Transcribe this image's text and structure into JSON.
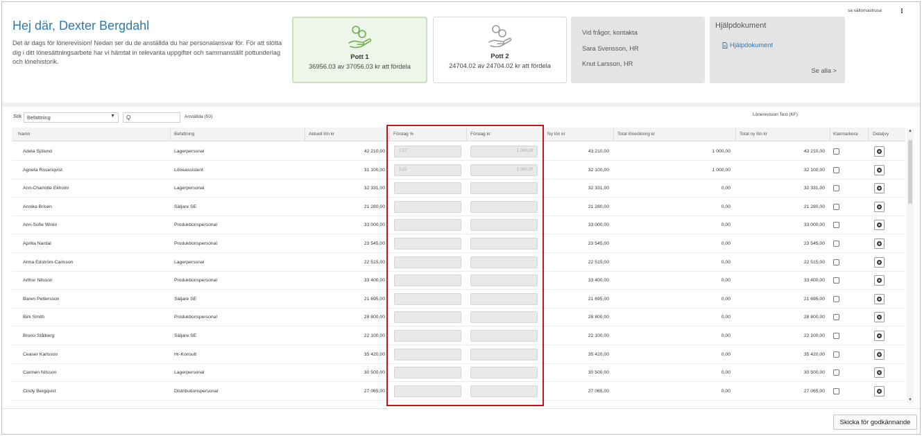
{
  "header": {
    "greeting": "Hej där, Dexter Bergdahl",
    "intro": "Det är dags för lönerevision! Nedan ser du de anställda du har personalansvar för. För att stötta dig i ditt lönesättningsarbete har vi hämtat in relevanta uppgifter och sammanställt pottunderlag och lönehistorik.",
    "user_name": "sa vällomastrusa",
    "menu_icon": "kebab-menu-icon"
  },
  "pots": [
    {
      "name": "Pott 1",
      "amount": "36956.03 av 37056.03 kr att fördela",
      "icon": "money-hand-icon",
      "color": "#6ab04c"
    },
    {
      "name": "Pott 2",
      "amount": "24704.02 av 24704.02 kr att fördela",
      "icon": "money-hand-icon",
      "color": "#9a9a9a"
    }
  ],
  "contact": {
    "title": "Vid frågor, kontakta",
    "people": [
      "Sara Svensson, HR",
      "Knut Larsson, HR"
    ]
  },
  "help": {
    "title": "Hjälpdokument",
    "link": "Hjälpdokument",
    "see_all": "Se alla >"
  },
  "toolbar": {
    "sok_label": "Sök",
    "select_value": "Befattning",
    "search_value": "Q",
    "employee_count": "Anställda (50)",
    "revision_name": "Lönerevision Test (KF)"
  },
  "table": {
    "headers": [
      "Namn",
      "Befattning",
      "Aktuell lön kr",
      "Förslag %",
      "Förslag kr",
      "Ny lön kr",
      "Total löneökning kr",
      "Total ny lön kr",
      "Klarmarkera",
      "Detaljvy"
    ],
    "rows": [
      {
        "name": "Adela Sjölund",
        "title": "Lagerpersonal",
        "current": "42 210,00",
        "pct": "2,37",
        "kr": "1 000,00",
        "new": "43 210,00",
        "increase": "1 000,00",
        "total": "43 210,00"
      },
      {
        "name": "Agneta Rosenqvist",
        "title": "Löneassistent",
        "current": "31 100,00",
        "pct": "3,22",
        "kr": "1 000,00",
        "new": "32 100,00",
        "increase": "1 000,00",
        "total": "32 100,00"
      },
      {
        "name": "Ann-Charlotte Ekholm",
        "title": "Lagerpersonal",
        "current": "32 331,00",
        "pct": "",
        "kr": "",
        "new": "32 331,00",
        "increase": "0,00",
        "total": "32 331,00"
      },
      {
        "name": "Annika Brisén",
        "title": "Säljare SE",
        "current": "21 280,00",
        "pct": "",
        "kr": "",
        "new": "21 280,00",
        "increase": "0,00",
        "total": "21 280,00"
      },
      {
        "name": "Ann-Sofie Wirén",
        "title": "Produktionspersonal",
        "current": "33 000,00",
        "pct": "",
        "kr": "",
        "new": "33 000,00",
        "increase": "0,00",
        "total": "33 000,00"
      },
      {
        "name": "Aprilia Nardal",
        "title": "Produktionspersonal",
        "current": "23 545,00",
        "pct": "",
        "kr": "",
        "new": "23 545,00",
        "increase": "0,00",
        "total": "23 545,00"
      },
      {
        "name": "Arma Edström-Carlsson",
        "title": "Lagerpersonal",
        "current": "22 515,00",
        "pct": "",
        "kr": "",
        "new": "22 515,00",
        "increase": "0,00",
        "total": "22 515,00"
      },
      {
        "name": "Arthur Nilsson",
        "title": "Produktionspersonal",
        "current": "33 400,00",
        "pct": "",
        "kr": "",
        "new": "33 400,00",
        "increase": "0,00",
        "total": "33 400,00"
      },
      {
        "name": "Baren Pettersson",
        "title": "Säljare SE",
        "current": "21 695,00",
        "pct": "",
        "kr": "",
        "new": "21 695,00",
        "increase": "0,00",
        "total": "21 695,00"
      },
      {
        "name": "Birk Smith",
        "title": "Produktionspersonal",
        "current": "28 800,00",
        "pct": "",
        "kr": "",
        "new": "28 800,00",
        "increase": "0,00",
        "total": "28 800,00"
      },
      {
        "name": "Bruno Ståiberg",
        "title": "Säljare SE",
        "current": "22 100,00",
        "pct": "",
        "kr": "",
        "new": "22 100,00",
        "increase": "0,00",
        "total": "22 100,00"
      },
      {
        "name": "Ceaser Karlsson",
        "title": "Hr-Konsult",
        "current": "35 420,00",
        "pct": "",
        "kr": "",
        "new": "35 420,00",
        "increase": "0,00",
        "total": "35 420,00"
      },
      {
        "name": "Carmen Nilsson",
        "title": "Lagerpersonal",
        "current": "30 500,00",
        "pct": "",
        "kr": "",
        "new": "30 500,00",
        "increase": "0,00",
        "total": "30 500,00"
      },
      {
        "name": "Cindy Bergqvist",
        "title": "Distributionspersonal",
        "current": "27 065,00",
        "pct": "",
        "kr": "",
        "new": "27 065,00",
        "increase": "0,00",
        "total": "27 065,00"
      }
    ]
  },
  "highlight_color": "#c0161e",
  "footer": {
    "submit": "Skicka för godkännande"
  }
}
